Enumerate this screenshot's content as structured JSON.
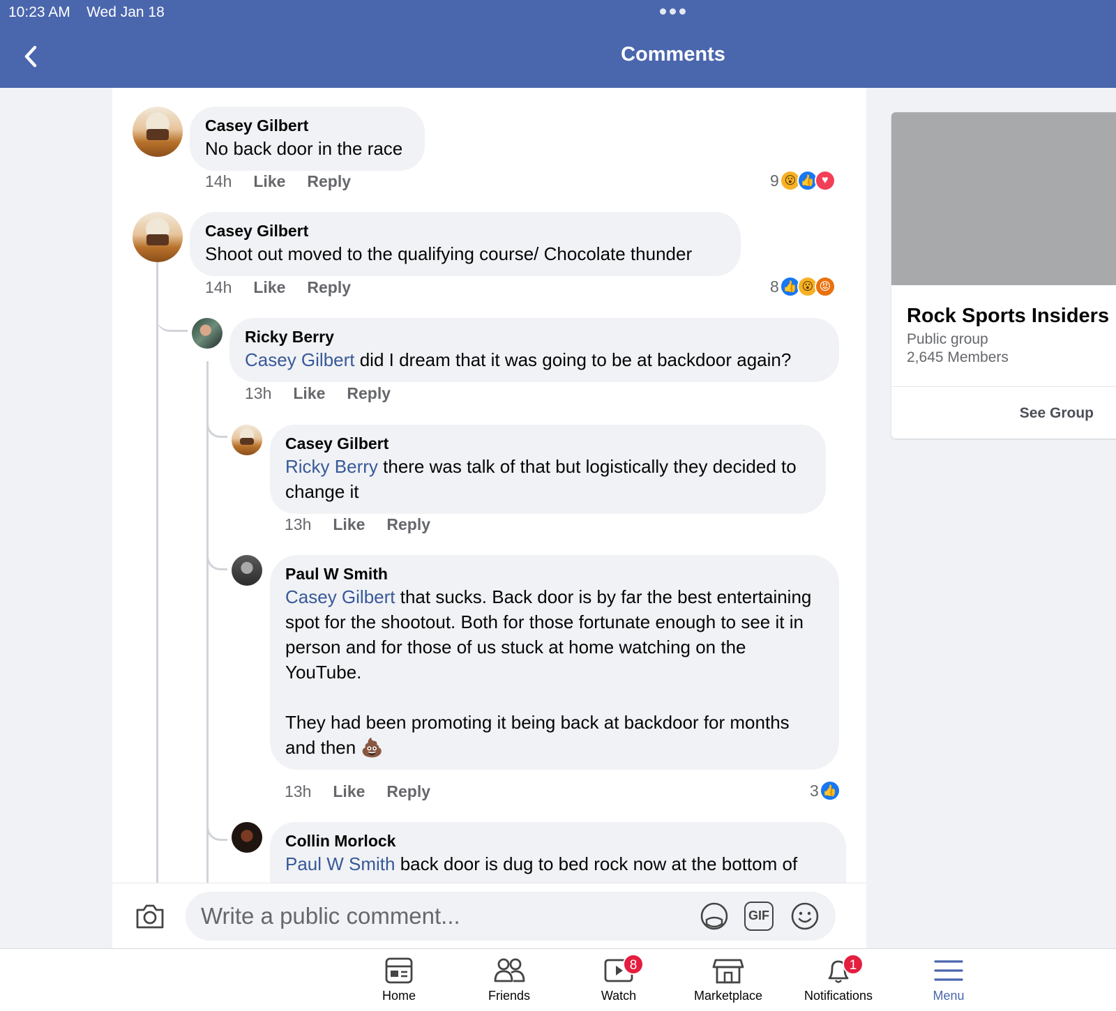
{
  "status_bar": {
    "time": "10:23 AM",
    "date": "Wed Jan 18"
  },
  "header": {
    "title": "Comments",
    "back_icon": "chevron-left-icon"
  },
  "comments": [
    {
      "author": "Casey Gilbert",
      "mention": "",
      "text": "No back door in the race",
      "time": "14h",
      "like_label": "Like",
      "reply_label": "Reply",
      "reaction_count": "9",
      "reactions": [
        "wow",
        "like",
        "love"
      ]
    },
    {
      "author": "Casey Gilbert",
      "mention": "",
      "text": "Shoot out moved to the qualifying course/ Chocolate thunder",
      "time": "14h",
      "like_label": "Like",
      "reply_label": "Reply",
      "reaction_count": "8",
      "reactions": [
        "like",
        "wow",
        "angry"
      ],
      "replies": [
        {
          "author": "Ricky Berry",
          "mention": "Casey Gilbert",
          "text": " did I dream that it was going to be at backdoor again?",
          "time": "13h",
          "like_label": "Like",
          "reply_label": "Reply"
        },
        {
          "author": "Casey Gilbert",
          "mention": "Ricky Berry",
          "text": " there was talk of that but logistically they decided to change it",
          "time": "13h",
          "like_label": "Like",
          "reply_label": "Reply"
        },
        {
          "author": "Paul W Smith",
          "mention": "Casey Gilbert",
          "text": " that sucks. Back door is by far the best entertaining spot for the shootout. Both for those fortunate enough to see it in person and for those of us stuck at home watching on the YouTube.\n\nThey had been promoting it being back at backdoor for months and then 💩",
          "time": "13h",
          "like_label": "Like",
          "reply_label": "Reply",
          "reaction_count": "3",
          "reactions": [
            "like"
          ]
        },
        {
          "author": "Collin Morlock",
          "mention": "Paul W Smith",
          "text": " back door is dug to bed rock now at the bottom of"
        }
      ]
    }
  ],
  "composer": {
    "placeholder": "Write a public comment...",
    "gif_label": "GIF"
  },
  "group_card": {
    "name": "Rock Sports Insiders",
    "type": "Public group",
    "members": "2,645 Members",
    "button": "See Group"
  },
  "tabbar": {
    "tabs": [
      {
        "label": "Home",
        "icon": "home-feed-icon"
      },
      {
        "label": "Friends",
        "icon": "friends-icon"
      },
      {
        "label": "Watch",
        "icon": "watch-icon",
        "badge": "8"
      },
      {
        "label": "Marketplace",
        "icon": "marketplace-icon"
      },
      {
        "label": "Notifications",
        "icon": "bell-icon",
        "badge": "1"
      },
      {
        "label": "Menu",
        "icon": "menu-icon",
        "active": true
      }
    ]
  },
  "colors": {
    "header": "#4a66ad",
    "mention": "#385898",
    "badge": "#e41e3f",
    "like": "#1877f2"
  }
}
